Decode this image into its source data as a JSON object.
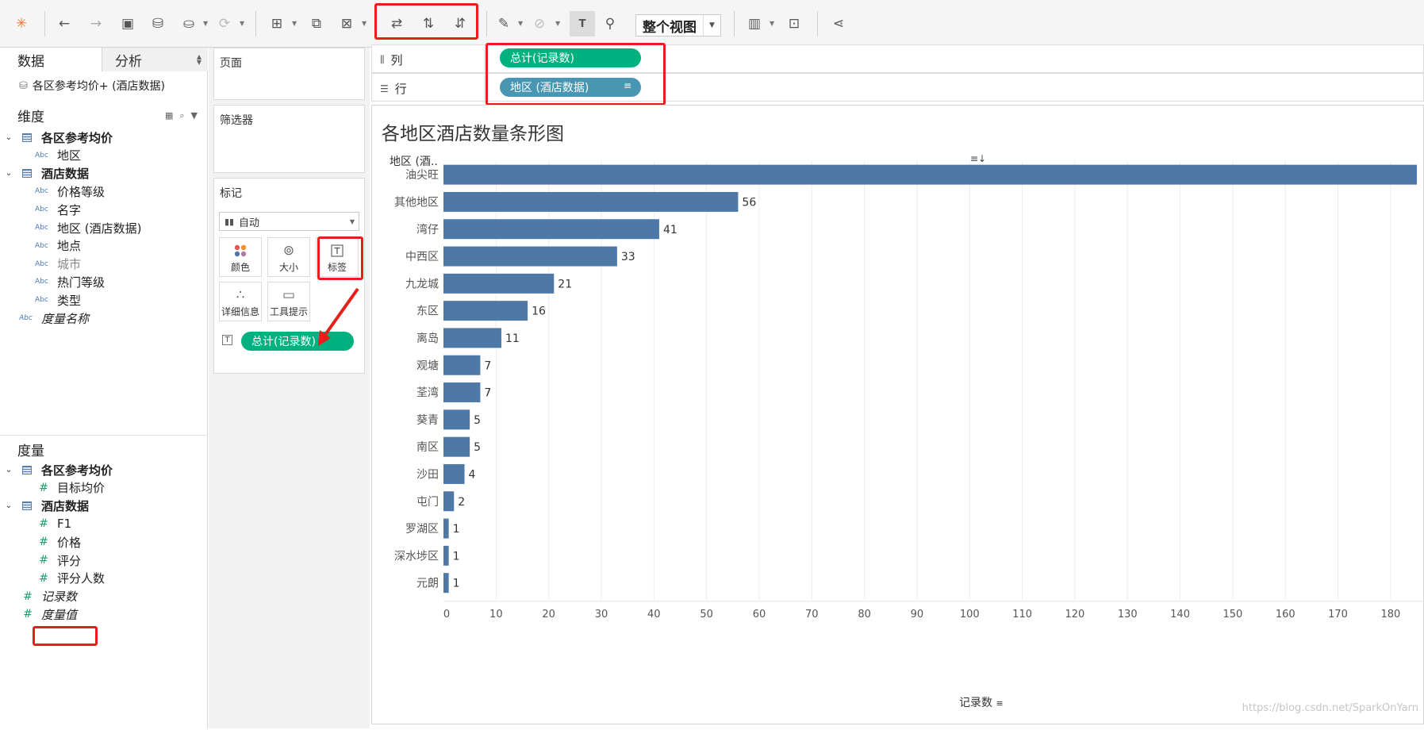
{
  "toolbar": {
    "view_mode": "整个视图",
    "icons": [
      "tableau-logo-icon",
      "back-icon",
      "forward-icon",
      "save-icon",
      "new-datasource-icon",
      "pause-update-icon",
      "refresh-icon",
      "new-worksheet-icon",
      "duplicate-sheet-icon",
      "clear-sheet-icon",
      "swap-rows-columns-icon",
      "sort-ascending-icon",
      "sort-descending-icon",
      "highlight-icon",
      "group-icon",
      "show-labels-icon",
      "pin-icon",
      "show-me-icon",
      "presentation-icon",
      "share-icon"
    ]
  },
  "data_pane": {
    "tab_data": "数据",
    "tab_analysis": "分析",
    "datasource": "各区参考均价+ (酒店数据)",
    "dimensions_title": "维度",
    "dimensions": [
      {
        "label": "各区参考均价",
        "kind": "table"
      },
      {
        "label": "地区",
        "kind": "abc"
      },
      {
        "label": "酒店数据",
        "kind": "table"
      },
      {
        "label": "价格等级",
        "kind": "abc"
      },
      {
        "label": "名字",
        "kind": "abc"
      },
      {
        "label": "地区 (酒店数据)",
        "kind": "abc"
      },
      {
        "label": "地点",
        "kind": "abc"
      },
      {
        "label": "城市",
        "kind": "abc"
      },
      {
        "label": "热门等级",
        "kind": "abc"
      },
      {
        "label": "类型",
        "kind": "abc"
      },
      {
        "label": "度量名称",
        "kind": "abc"
      }
    ],
    "measures_title": "度量",
    "measures": [
      {
        "label": "各区参考均价",
        "kind": "table"
      },
      {
        "label": "目标均价",
        "kind": "hash"
      },
      {
        "label": "酒店数据",
        "kind": "table"
      },
      {
        "label": "F1",
        "kind": "hash"
      },
      {
        "label": "价格",
        "kind": "hash"
      },
      {
        "label": "评分",
        "kind": "hash"
      },
      {
        "label": "评分人数",
        "kind": "hash"
      },
      {
        "label": "记录数",
        "kind": "hash"
      },
      {
        "label": "度量值",
        "kind": "hash"
      }
    ]
  },
  "shelves": {
    "pages_title": "页面",
    "filters_title": "筛选器",
    "marks_title": "标记",
    "mark_type": "自动",
    "mark_buttons": {
      "color": "颜色",
      "size": "大小",
      "label": "标签",
      "detail": "详细信息",
      "tooltip": "工具提示"
    },
    "label_pill": "总计(记录数)",
    "columns_label": "列",
    "rows_label": "行",
    "columns_pill": "总计(记录数)",
    "rows_pill": "地区 (酒店数据)"
  },
  "chart": {
    "title": "各地区酒店数量条形图",
    "row_header": "地区 (酒..",
    "xlabel": "记录数",
    "watermark": "https://blog.csdn.net/SparkOnYarn"
  },
  "chart_data": {
    "type": "bar",
    "orientation": "horizontal",
    "title": "各地区酒店数量条形图",
    "xlabel": "记录数",
    "ylabel": "地区 (酒..",
    "categories": [
      "油尖旺",
      "其他地区",
      "湾仔",
      "中西区",
      "九龙城",
      "东区",
      "离岛",
      "观塘",
      "荃湾",
      "葵青",
      "南区",
      "沙田",
      "屯门",
      "罗湖区",
      "深水埗区",
      "元朗"
    ],
    "values": [
      185,
      56,
      41,
      33,
      21,
      16,
      11,
      7,
      7,
      5,
      5,
      4,
      2,
      1,
      1,
      1
    ],
    "value_labels": [
      "",
      "56",
      "41",
      "33",
      "21",
      "16",
      "11",
      "7",
      "7",
      "5",
      "5",
      "4",
      "2",
      "1",
      "1",
      "1"
    ],
    "xticks": [
      0,
      10,
      20,
      30,
      40,
      50,
      60,
      70,
      80,
      90,
      100,
      110,
      120,
      130,
      140,
      150,
      160,
      170,
      180
    ],
    "xlim": [
      0,
      185
    ],
    "bar_color": "#4e79a7",
    "grid": "vertical"
  }
}
